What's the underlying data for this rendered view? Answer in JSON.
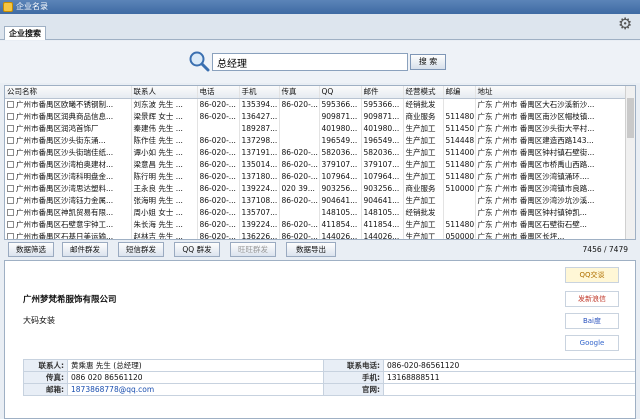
{
  "window": {
    "title": "企业名录"
  },
  "tab": {
    "label": "企业搜索"
  },
  "search": {
    "value": "总经理",
    "button": "搜 索"
  },
  "grid": {
    "columns": [
      "公司名称",
      "联系人",
      "电话",
      "手机",
      "传真",
      "QQ",
      "邮件",
      "经营模式",
      "邮编",
      "地址"
    ],
    "rows": [
      [
        "广州市番禺区欧曦不锈钢制...",
        "刘东波 先生 ...",
        "86-020-...",
        "135394...",
        "86-020-...",
        "595366...",
        "595366...",
        "经销批发",
        "",
        "广东 广州市 番禺区大石沙溪新沙..."
      ],
      [
        "广州市番禺区润典商品信息...",
        "梁景辉 女士 ...",
        "86-020-...",
        "136427...",
        "",
        "909871...",
        "909871...",
        "商业服务",
        "511480",
        "广东 广州市 番禺区南沙区帽枝镇..."
      ],
      [
        "广州市番禺区润鸿首饰厂",
        "秦建伟 先生 ...",
        "",
        "189287...",
        "",
        "401980...",
        "401980...",
        "生产加工",
        "511450",
        "广东 广州市 番禺区沙头街大平村..."
      ],
      [
        "广州市番禺区沙头街东涌...",
        "陈作佳 先生 ...",
        "86-020-...",
        "137298...",
        "",
        "196549...",
        "196549...",
        "生产加工",
        "514448",
        "广东 广州市 番禺区建造西路143..."
      ],
      [
        "广州市番禺区沙头街瑞佳纸...",
        "谭小如 先生 ...",
        "86-020-...",
        "137191...",
        "86-020-...",
        "582036...",
        "582036...",
        "生产加工",
        "511400",
        "广东 广州市 番禺区钟村镇石壁街..."
      ],
      [
        "广州市番禺区沙湾柏奥建材...",
        "梁意昌 先生 ...",
        "86-020-...",
        "135014...",
        "86-020-...",
        "379107...",
        "379107...",
        "生产加工",
        "511480",
        "广东 广州市 番禺区市桥禹山西路..."
      ],
      [
        "广州市番禺区沙湾科明盘金...",
        "陈行明 先生 ...",
        "86-020-...",
        "137180...",
        "86-020-...",
        "107964...",
        "107964...",
        "生产加工",
        "511480",
        "广东 广州市 番禺区沙湾镇涌环...."
      ],
      [
        "广州市番禺区沙湾思达塑料...",
        "王永良 先生 ...",
        "86-020-...",
        "139224...",
        "020 39...",
        "903256...",
        "903256...",
        "商业服务",
        "510000",
        "广东 广州市 番禺区沙湾镇市良路..."
      ],
      [
        "广州市番禺区沙湾钰力金属...",
        "张海明 先生 ...",
        "86-020-...",
        "137108...",
        "86-020-...",
        "904641...",
        "904641...",
        "生产加工",
        "",
        "广东 广州市 番禺区沙湾沙坑沙溪..."
      ],
      [
        "广州市番禺区神凯贸易有限...",
        "周小姐 女士 ...",
        "86-020-...",
        "135707...",
        "",
        "148105...",
        "148105...",
        "经销批发",
        "",
        "广东 广州市 番禺区钟村镇钟凯..."
      ],
      [
        "广州市番禺区石壁意宇钟工...",
        "朱长海 先生 ...",
        "86-020-...",
        "139224...",
        "86-020-...",
        "411854...",
        "411854...",
        "生产加工",
        "511480",
        "广东 广州市 番禺区石壁街石壁..."
      ],
      [
        "广州市番禺区石基日美运输...",
        "赵林吉 先生 ...",
        "86-020-...",
        "136226...",
        "86-020-...",
        "144026...",
        "144026...",
        "生产加工",
        "050000",
        "广东 广州市 番禺区长坪..."
      ]
    ]
  },
  "toolbar": {
    "buttons": [
      "数据筛选",
      "邮件群发",
      "短信群发",
      "QQ 群发",
      "旺旺群发",
      "数据导出"
    ],
    "counter": "7456 / 7479"
  },
  "detail": {
    "company": "广州梦梵希服饰有限公司",
    "business": "大码女装",
    "links": [
      "QQ交谈",
      "发新浪信",
      "Bai度",
      "Google"
    ],
    "info": {
      "contact_label": "联系人:",
      "contact_value": "黄乘惠 先生 (总经理)",
      "phone_label": "联系电话:",
      "phone_value": "086-020-86561120",
      "fax_label": "传真:",
      "fax_value": "086 020 86561120",
      "mobile_label": "手机:",
      "mobile_value": "13168888511",
      "email_label": "邮箱:",
      "email_value": "1873868778@qq.com",
      "web_label": "官网:",
      "web_value": ""
    }
  },
  "colors": {
    "header": "#3e6aa3",
    "selection": "#cfe2f7"
  }
}
